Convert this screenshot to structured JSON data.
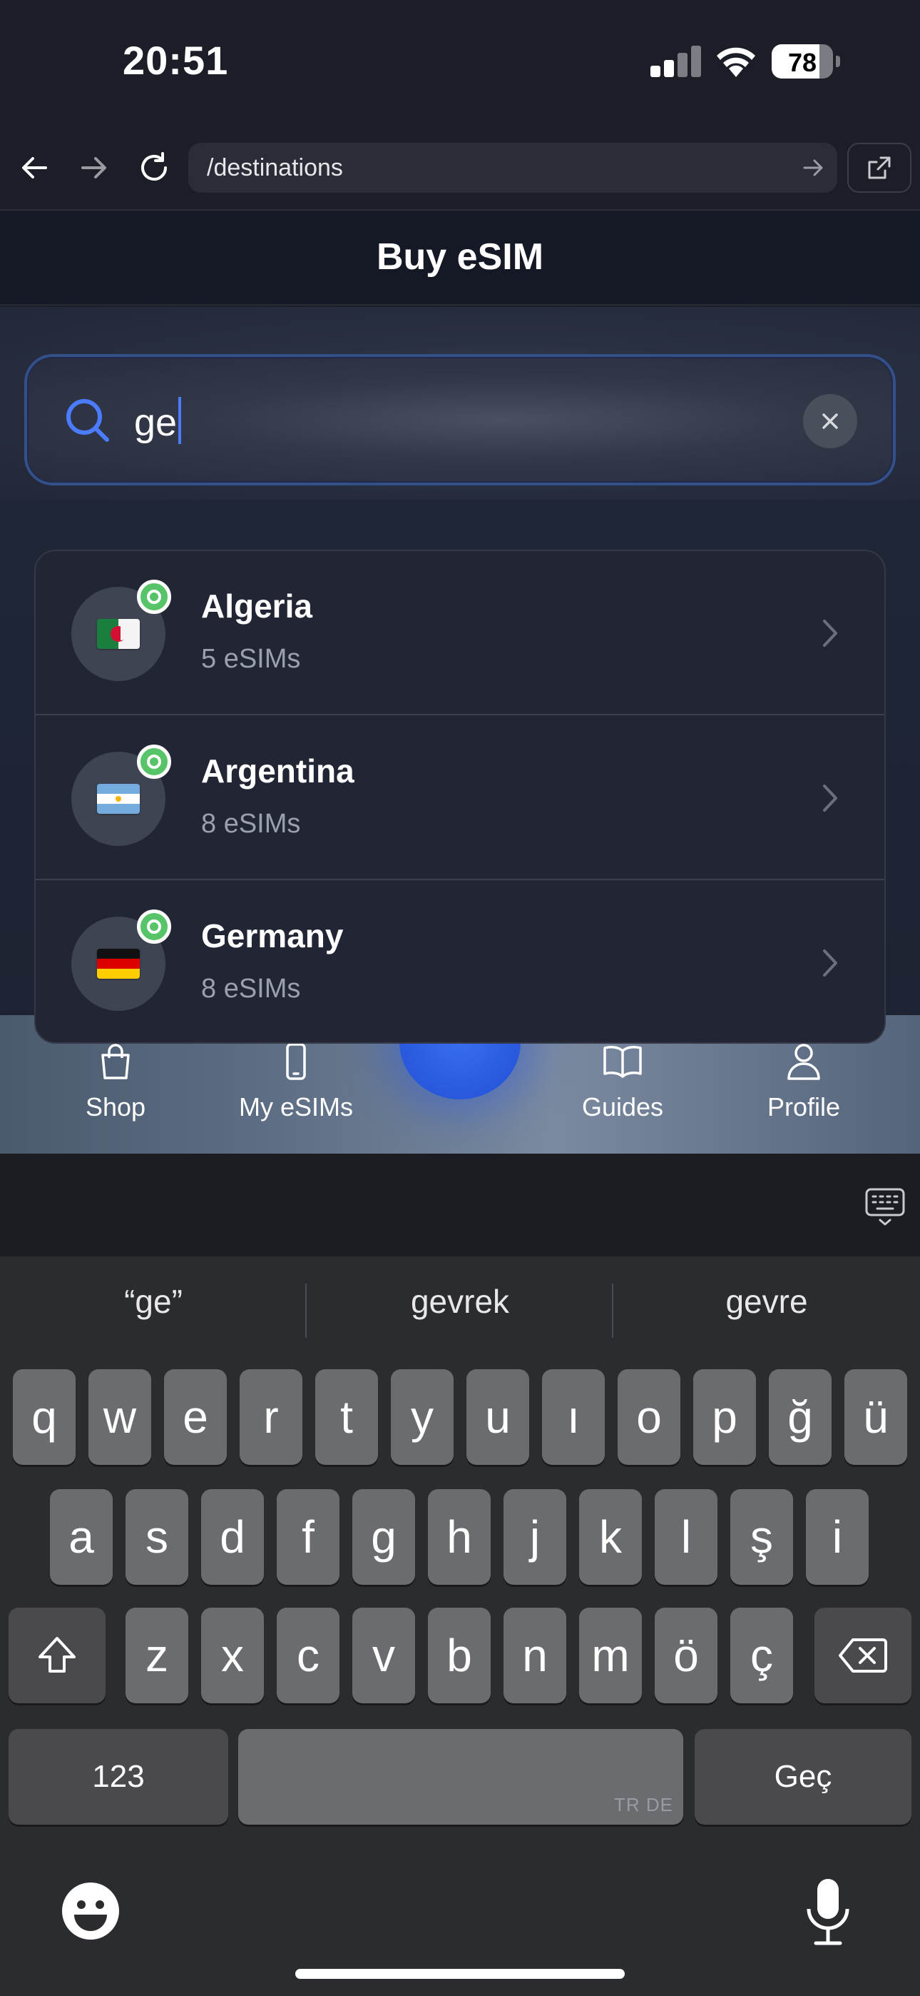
{
  "status_bar": {
    "time": "20:51",
    "battery": "78",
    "battery_level": 0.78
  },
  "browser": {
    "url": "/destinations"
  },
  "header": {
    "title": "Buy eSIM"
  },
  "search": {
    "value": "ge"
  },
  "results": [
    {
      "name": "Algeria",
      "count": "5 eSIMs",
      "flag": "algeria-flag"
    },
    {
      "name": "Argentina",
      "count": "8 eSIMs",
      "flag": "argentina-flag"
    },
    {
      "name": "Germany",
      "count": "8 eSIMs",
      "flag": "germany-flag"
    }
  ],
  "tabs": [
    {
      "label": "Shop",
      "icon": "bag-icon"
    },
    {
      "label": "My eSIMs",
      "icon": "phone-icon"
    },
    {
      "label": "Guides",
      "icon": "book-icon"
    },
    {
      "label": "Profile",
      "icon": "person-icon"
    }
  ],
  "keyboard": {
    "suggestions": [
      "“ge”",
      "gevrek",
      "gevre"
    ],
    "row1": [
      "q",
      "w",
      "e",
      "r",
      "t",
      "y",
      "u",
      "ı",
      "o",
      "p",
      "ğ",
      "ü"
    ],
    "row2": [
      "a",
      "s",
      "d",
      "f",
      "g",
      "h",
      "j",
      "k",
      "l",
      "ş",
      "i"
    ],
    "row3": [
      "z",
      "x",
      "c",
      "v",
      "b",
      "n",
      "m",
      "ö",
      "ç"
    ],
    "numbers_label": "123",
    "space_lang": "TR DE",
    "return_label": "Geç"
  },
  "colors": {
    "accent": "#2a5be0",
    "online": "#58c46a",
    "background": "#1c1e28"
  }
}
